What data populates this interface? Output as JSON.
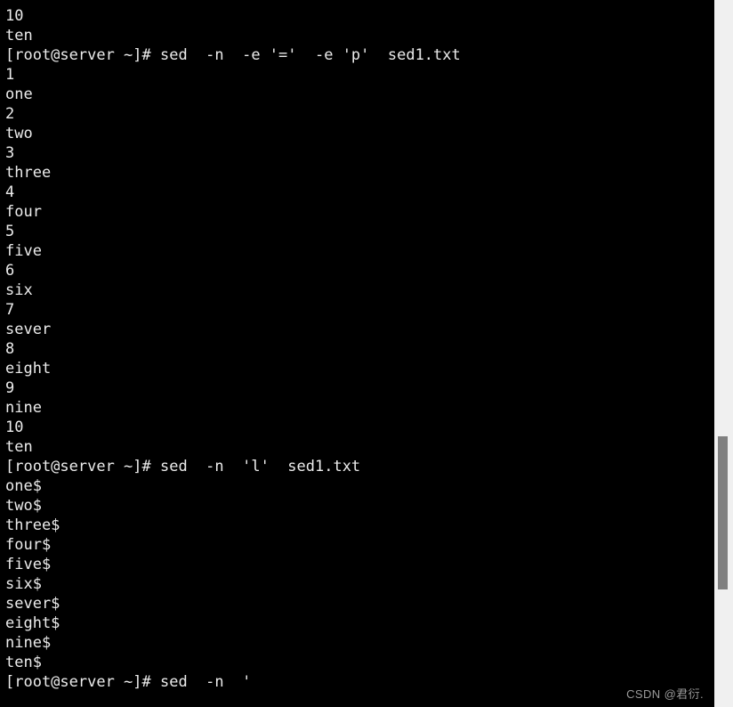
{
  "window": {
    "type": "terminal-console",
    "background_color": "#000000",
    "text_color": "#ececec"
  },
  "terminal": {
    "prompt": "[root@server ~]#",
    "lines": [
      "10",
      "ten",
      "[root@server ~]# sed  -n  -e '='  -e 'p'  sed1.txt",
      "1",
      "one",
      "2",
      "two",
      "3",
      "three",
      "4",
      "four",
      "5",
      "five",
      "6",
      "six",
      "7",
      "sever",
      "8",
      "eight",
      "9",
      "nine",
      "10",
      "ten",
      "[root@server ~]# sed  -n  'l'  sed1.txt",
      "one$",
      "two$",
      "three$",
      "four$",
      "five$",
      "six$",
      "sever$",
      "eight$",
      "nine$",
      "ten$",
      "[root@server ~]# sed  -n  '"
    ],
    "commands": [
      "sed  -n  -e '='  -e 'p'  sed1.txt",
      "sed  -n  'l'  sed1.txt",
      "sed  -n  '"
    ]
  },
  "watermark": {
    "text": "CSDN @君衍."
  },
  "scrollbar": {
    "track_color": "#f0f0f0",
    "thumb_color": "#808080"
  }
}
